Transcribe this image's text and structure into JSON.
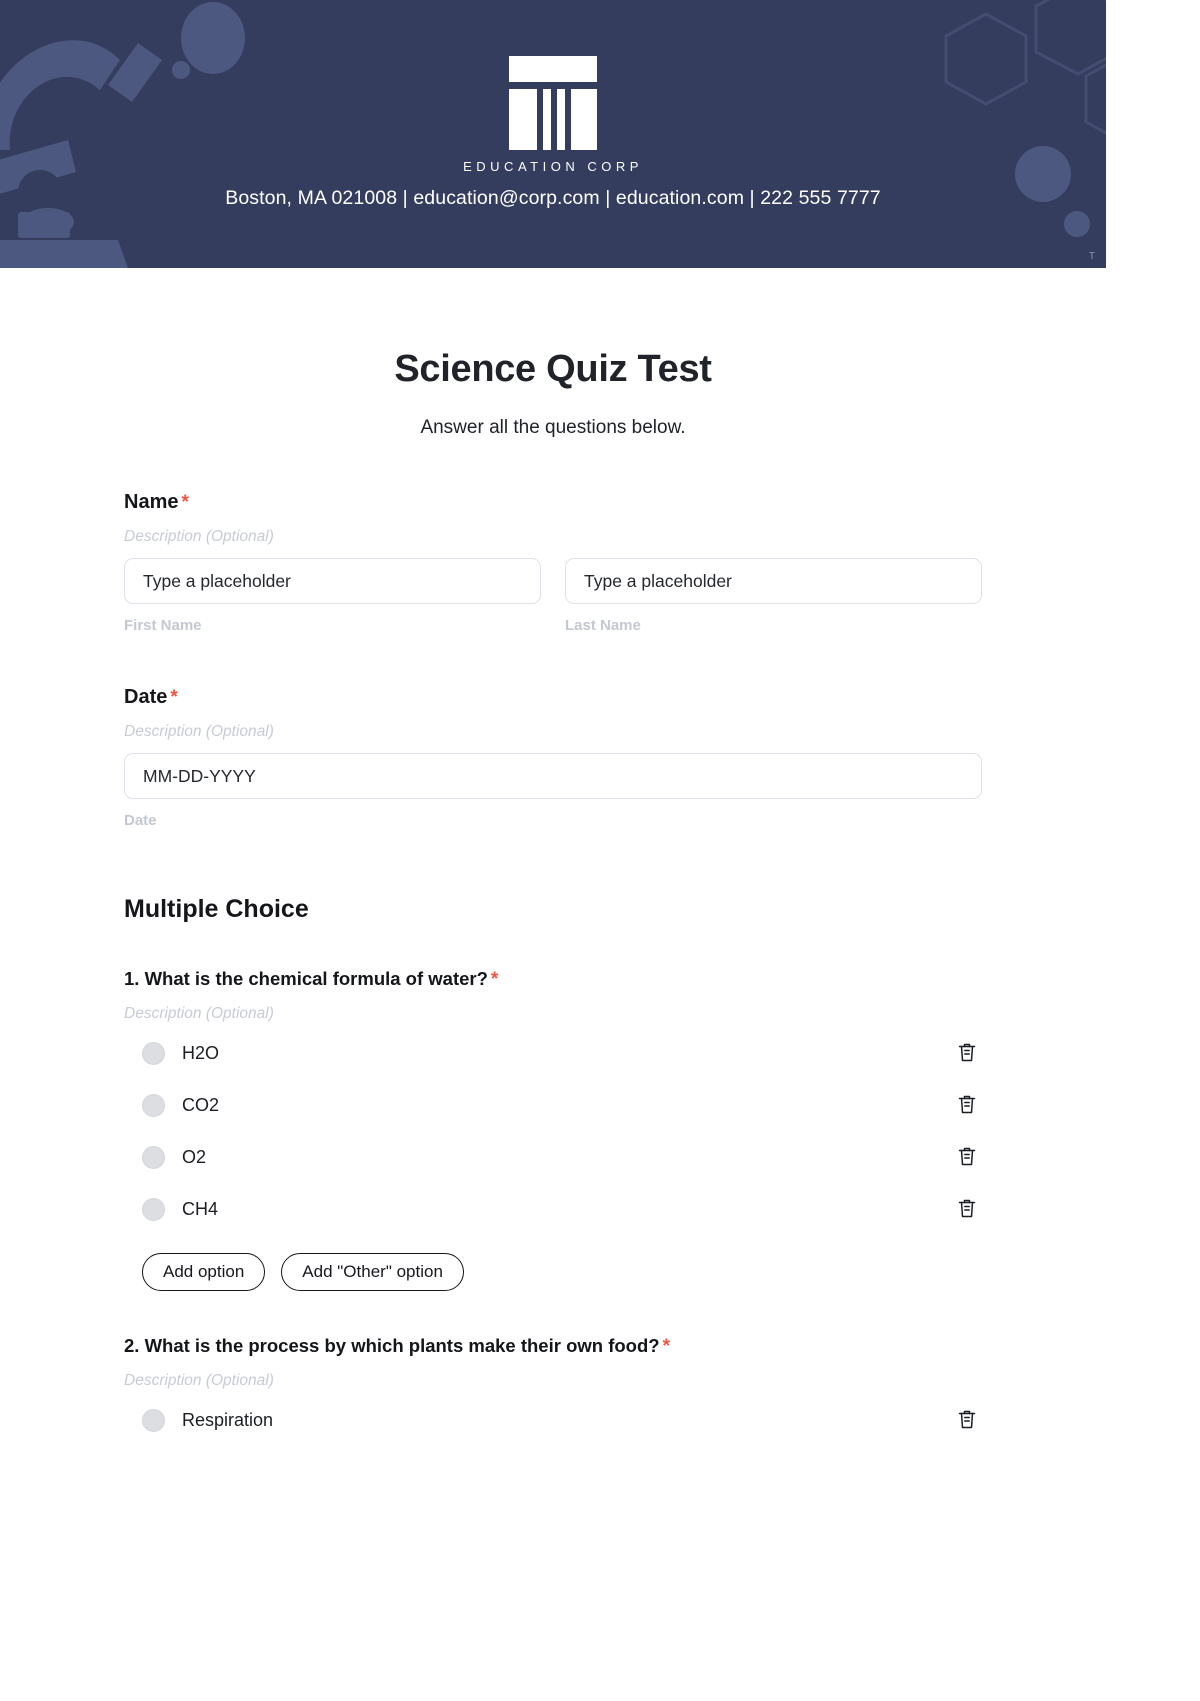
{
  "header": {
    "logo_name": "EDUCATION CORP",
    "contact": "Boston, MA 021008 | education@corp.com | education.com | 222 555 7777",
    "trademark": "T",
    "background_color": "#343d5e",
    "accent_shape_color": "#4d5880"
  },
  "form": {
    "title": "Science Quiz Test",
    "subtitle": "Answer all the questions below.",
    "required_marker": "*",
    "description_placeholder": "Description (Optional)",
    "required_color": "#f2543d"
  },
  "fields": [
    {
      "label": "Name",
      "required": "*",
      "description": "Description (Optional)",
      "inputs": [
        {
          "placeholder": "Type a placeholder",
          "sub_label": "First Name"
        },
        {
          "placeholder": "Type a placeholder",
          "sub_label": "Last Name"
        }
      ]
    },
    {
      "label": "Date",
      "required": "*",
      "description": "Description (Optional)",
      "inputs": [
        {
          "placeholder": "MM-DD-YYYY",
          "sub_label": "Date"
        }
      ]
    }
  ],
  "section": {
    "heading": "Multiple Choice"
  },
  "questions": [
    {
      "title": "1. What is the chemical formula of water?",
      "required": "*",
      "description": "Description (Optional)",
      "options": [
        "H2O",
        "CO2",
        "O2",
        "CH4"
      ],
      "buttons": {
        "add_option": "Add option",
        "add_other_option": "Add \"Other\" option"
      }
    },
    {
      "title": "2. What is the process by which plants make their own food?",
      "required": "*",
      "description": "Description (Optional)",
      "options": [
        "Respiration"
      ]
    }
  ]
}
